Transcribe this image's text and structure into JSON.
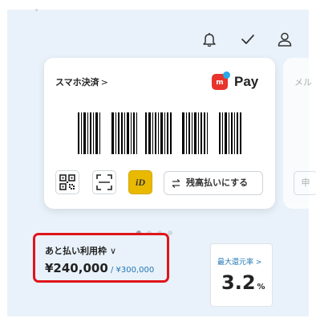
{
  "header": {
    "icons": [
      "bell-icon",
      "check-icon",
      "user-icon"
    ]
  },
  "card": {
    "title": "スマホ決済",
    "chevron": ">",
    "logo_m": "m",
    "logo_text": "Pay",
    "switch_label": "残高払いにする",
    "id_label": "iD"
  },
  "next_card": {
    "title": "メル",
    "button": "申"
  },
  "carousel": {
    "pages": 4,
    "active": 1
  },
  "credit": {
    "label": "あと払い利用枠",
    "chevron": "∨",
    "amount": "¥240,000",
    "limit": " / ¥300,000"
  },
  "rate": {
    "label": "最大還元率 >",
    "value": "3.2",
    "unit": "%"
  },
  "colors": {
    "background": "#e9f2fa",
    "accent_red": "#e1141b",
    "link_blue": "#2477b5",
    "id_yellow": "#e9b900",
    "merpay_red": "#e8342c"
  }
}
